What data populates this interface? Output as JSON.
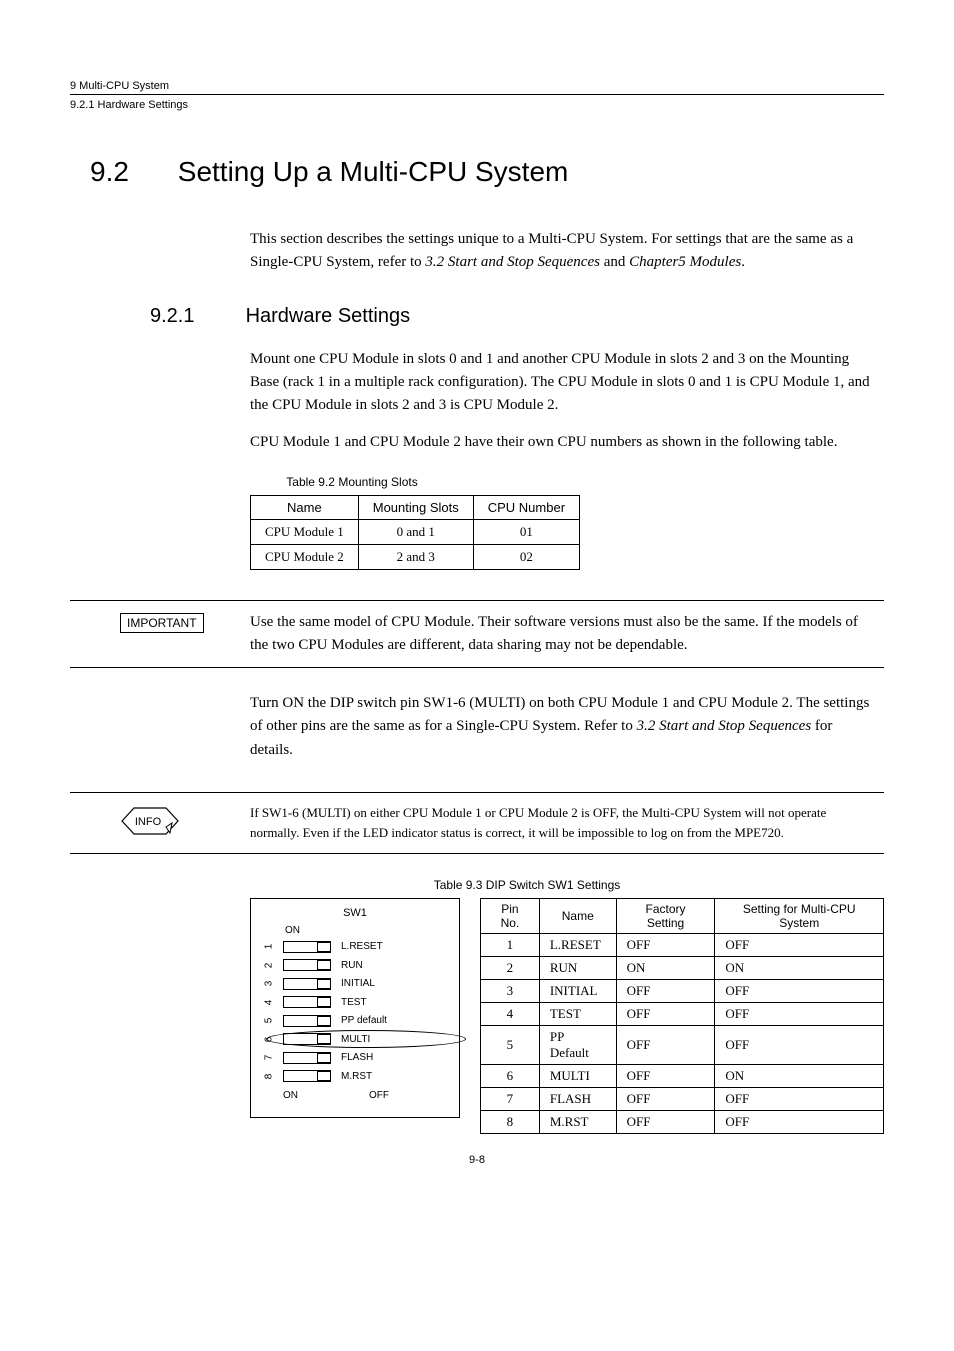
{
  "header": {
    "chapter_line": "9  Multi-CPU System",
    "section_line": "9.2.1  Hardware Settings"
  },
  "section": {
    "number": "9.2",
    "title": "Setting Up a Multi-CPU System",
    "intro_p1_a": "This section describes the settings unique to a Multi-CPU System. For settings that are the same as a Single-CPU System, refer to ",
    "intro_p1_ref1": "3.2  Start and Stop Sequences",
    "intro_p1_b": " and ",
    "intro_p1_ref2": "Chapter5 Modules",
    "intro_p1_c": "."
  },
  "subsection": {
    "number": "9.2.1",
    "title": "Hardware Settings",
    "p1": "Mount one CPU Module in slots 0 and 1 and another CPU Module in slots 2 and 3 on the Mounting Base (rack 1 in a multiple rack configuration). The CPU Module in slots 0 and 1 is CPU Module 1, and the CPU Module in slots 2 and 3 is CPU Module 2.",
    "p2": "CPU Module 1 and CPU Module 2 have their own CPU numbers as shown in the following table."
  },
  "table92": {
    "caption": "Table 9.2  Mounting Slots",
    "headers": {
      "c1": "Name",
      "c2": "Mounting Slots",
      "c3": "CPU Number"
    },
    "rows": [
      {
        "name": "CPU Module 1",
        "slots": "0 and 1",
        "num": "01"
      },
      {
        "name": "CPU Module 2",
        "slots": "2 and 3",
        "num": "02"
      }
    ]
  },
  "important": {
    "label": "IMPORTANT",
    "text": "Use the same model of CPU Module. Their software versions must also be the same. If the models of the two CPU Modules are different, data sharing may not be dependable."
  },
  "midpara": {
    "a": "Turn ON the DIP switch pin SW1-6 (MULTI) on both CPU Module 1 and CPU Module 2. The settings of other pins are the same as for a Single-CPU System. Refer to ",
    "ref": "3.2  Start and Stop Sequences",
    "b": " for details."
  },
  "info": {
    "label": "INFO",
    "text": "If SW1-6 (MULTI) on either CPU Module 1 or CPU Module 2 is OFF, the Multi-CPU System will not operate normally. Even if the LED indicator status is correct, it will be impossible to log on from the MPE720."
  },
  "table93": {
    "caption": "Table 9.3  DIP Switch SW1 Settings",
    "headers": {
      "c1": "Pin No.",
      "c2": "Name",
      "c3": "Factory Setting",
      "c4": "Setting for Multi-CPU System"
    },
    "rows": [
      {
        "pin": "1",
        "name": "L.RESET",
        "factory": "OFF",
        "multi": "OFF"
      },
      {
        "pin": "2",
        "name": "RUN",
        "factory": "ON",
        "multi": "ON"
      },
      {
        "pin": "3",
        "name": "INITIAL",
        "factory": "OFF",
        "multi": "OFF"
      },
      {
        "pin": "4",
        "name": "TEST",
        "factory": "OFF",
        "multi": "OFF"
      },
      {
        "pin": "5",
        "name": "PP  Default",
        "factory": "OFF",
        "multi": "OFF"
      },
      {
        "pin": "6",
        "name": "MULTI",
        "factory": "OFF",
        "multi": "ON"
      },
      {
        "pin": "7",
        "name": "FLASH",
        "factory": "OFF",
        "multi": "OFF"
      },
      {
        "pin": "8",
        "name": "M.RST",
        "factory": "OFF",
        "multi": "OFF"
      }
    ]
  },
  "dip_diagram": {
    "title": "SW1",
    "on": "ON",
    "off": "OFF",
    "switches": [
      {
        "n": "1",
        "label": "L.RESET",
        "pos": "off"
      },
      {
        "n": "2",
        "label": "RUN",
        "pos": "off"
      },
      {
        "n": "3",
        "label": "INITIAL",
        "pos": "off"
      },
      {
        "n": "4",
        "label": "TEST",
        "pos": "off"
      },
      {
        "n": "5",
        "label": "PP default",
        "pos": "off"
      },
      {
        "n": "6",
        "label": "MULTI",
        "pos": "off"
      },
      {
        "n": "7",
        "label": "FLASH",
        "pos": "off"
      },
      {
        "n": "8",
        "label": "M.RST",
        "pos": "off"
      }
    ]
  },
  "page_number": "9-8"
}
